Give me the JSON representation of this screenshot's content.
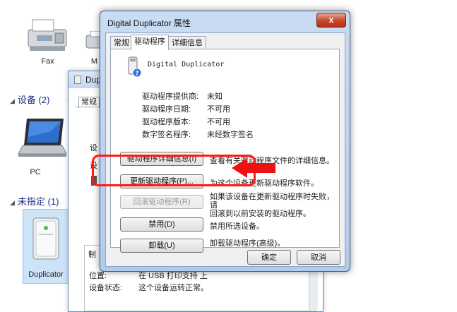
{
  "explorer": {
    "devices": [
      {
        "label": "Fax",
        "icon": "fax-icon"
      },
      {
        "label": "M",
        "icon": "printer-icon"
      },
      {
        "label": "PC",
        "icon": "laptop-icon"
      },
      {
        "label": "Duplicator",
        "icon": "usb-drive-icon"
      }
    ],
    "sections": [
      {
        "label": "设备 (2)"
      },
      {
        "label": "未指定 (1)"
      }
    ]
  },
  "back_window": {
    "title": "Dup",
    "tab": "常规",
    "partial_labels": [
      "设",
      "设",
      "制",
      "位置:"
    ],
    "location_value": "在 USB 打印支持 上",
    "status_label": "设备状态:",
    "status_value": "这个设备运转正常。"
  },
  "dialog": {
    "title": "Digital Duplicator 属性",
    "close_label": "x",
    "tabs": [
      "常规",
      "驱动程序",
      "详细信息"
    ],
    "active_tab": "驱动程序",
    "device_name": "Digital Duplicator",
    "properties": [
      {
        "label": "驱动程序提供商:",
        "value": "未知"
      },
      {
        "label": "驱动程序日期:",
        "value": "不可用"
      },
      {
        "label": "驱动程序版本:",
        "value": "不可用"
      },
      {
        "label": "数字签名程序:",
        "value": "未经数字签名"
      }
    ],
    "actions": [
      {
        "button": "驱动程序详细信息(I)",
        "desc": "查看有关驱动程序文件的详细信息。",
        "enabled": true
      },
      {
        "button": "更新驱动程序(P)...",
        "desc": "为这个设备更新驱动程序软件。",
        "enabled": true
      },
      {
        "button": "回滚驱动程序(R)",
        "desc": "如果该设备在更新驱动程序时失败，请回滚到以前安装的驱动程序。",
        "desc_line1": "如果该设备在更新驱动程序时失败，请",
        "desc_line2": "回滚到以前安装的驱动程序。",
        "enabled": false
      },
      {
        "button": "禁用(D)",
        "desc": "禁用所选设备。",
        "enabled": true
      },
      {
        "button": "卸载(U)",
        "desc": "卸载驱动程序(高级)。",
        "enabled": true
      }
    ],
    "ok_label": "确定",
    "cancel_label": "取消"
  },
  "colors": {
    "highlight": "#ff1a1a",
    "arrow": "#ee1111",
    "section_text": "#1e3287"
  }
}
